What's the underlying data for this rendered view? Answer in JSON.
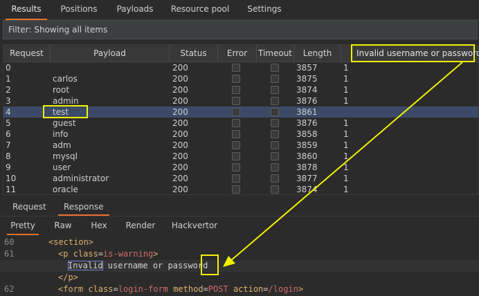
{
  "tabs": [
    "Results",
    "Positions",
    "Payloads",
    "Resource pool",
    "Settings"
  ],
  "filter": "Filter: Showing all items",
  "columns": [
    "Request",
    "Payload",
    "Status",
    "Error",
    "Timeout",
    "Length"
  ],
  "grep_column_label": "Invalid username or password.",
  "rows": [
    {
      "request": "0",
      "payload": "",
      "status": "200",
      "length": "3857",
      "grep": "1"
    },
    {
      "request": "1",
      "payload": "carlos",
      "status": "200",
      "length": "3875",
      "grep": "1"
    },
    {
      "request": "2",
      "payload": "root",
      "status": "200",
      "length": "3874",
      "grep": "1"
    },
    {
      "request": "3",
      "payload": "admin",
      "status": "200",
      "length": "3876",
      "grep": "1"
    },
    {
      "request": "4",
      "payload": "test",
      "status": "200",
      "length": "3861",
      "grep": ""
    },
    {
      "request": "5",
      "payload": "guest",
      "status": "200",
      "length": "3876",
      "grep": "1"
    },
    {
      "request": "6",
      "payload": "info",
      "status": "200",
      "length": "3858",
      "grep": "1"
    },
    {
      "request": "7",
      "payload": "adm",
      "status": "200",
      "length": "3859",
      "grep": "1"
    },
    {
      "request": "8",
      "payload": "mysql",
      "status": "200",
      "length": "3860",
      "grep": "1"
    },
    {
      "request": "9",
      "payload": "user",
      "status": "200",
      "length": "3878",
      "grep": "1"
    },
    {
      "request": "10",
      "payload": "administrator",
      "status": "200",
      "length": "3877",
      "grep": "1"
    },
    {
      "request": "11",
      "payload": "oracle",
      "status": "200",
      "length": "3874",
      "grep": "1"
    }
  ],
  "selected_request": "4",
  "message_tabs": [
    "Request",
    "Response"
  ],
  "view_tabs": [
    "Pretty",
    "Raw",
    "Hex",
    "Render",
    "Hackvertor"
  ],
  "code_lines": [
    {
      "num": "60",
      "text": "<section>"
    },
    {
      "num": "61",
      "text": "<p class=is-warning>"
    },
    {
      "num": "",
      "text": "Invalid username or password"
    },
    {
      "num": "",
      "text": "</p>"
    },
    {
      "num": "62",
      "text": "<form class=login-form method=POST action=/login>"
    }
  ],
  "code": {
    "section_tag": "<section>",
    "p_open": "<p ",
    "p_attr": "class",
    "p_eq": "=",
    "p_val": "is-warning",
    "p_close": ">",
    "warn_word": "Invalid",
    "warn_rest": " username or password",
    "p_end": "</p>",
    "form_open": "<form ",
    "form_class_attr": "class",
    "form_class_val": "login-form",
    "form_method_attr": "method",
    "form_method_val": "POST",
    "form_action_attr": "action",
    "form_action_val": "/login",
    "form_close": ">",
    "eq": "="
  },
  "colors": {
    "accent": "#e8722c",
    "annotation": "#f2f200",
    "selected_row": "#3b4a66"
  }
}
